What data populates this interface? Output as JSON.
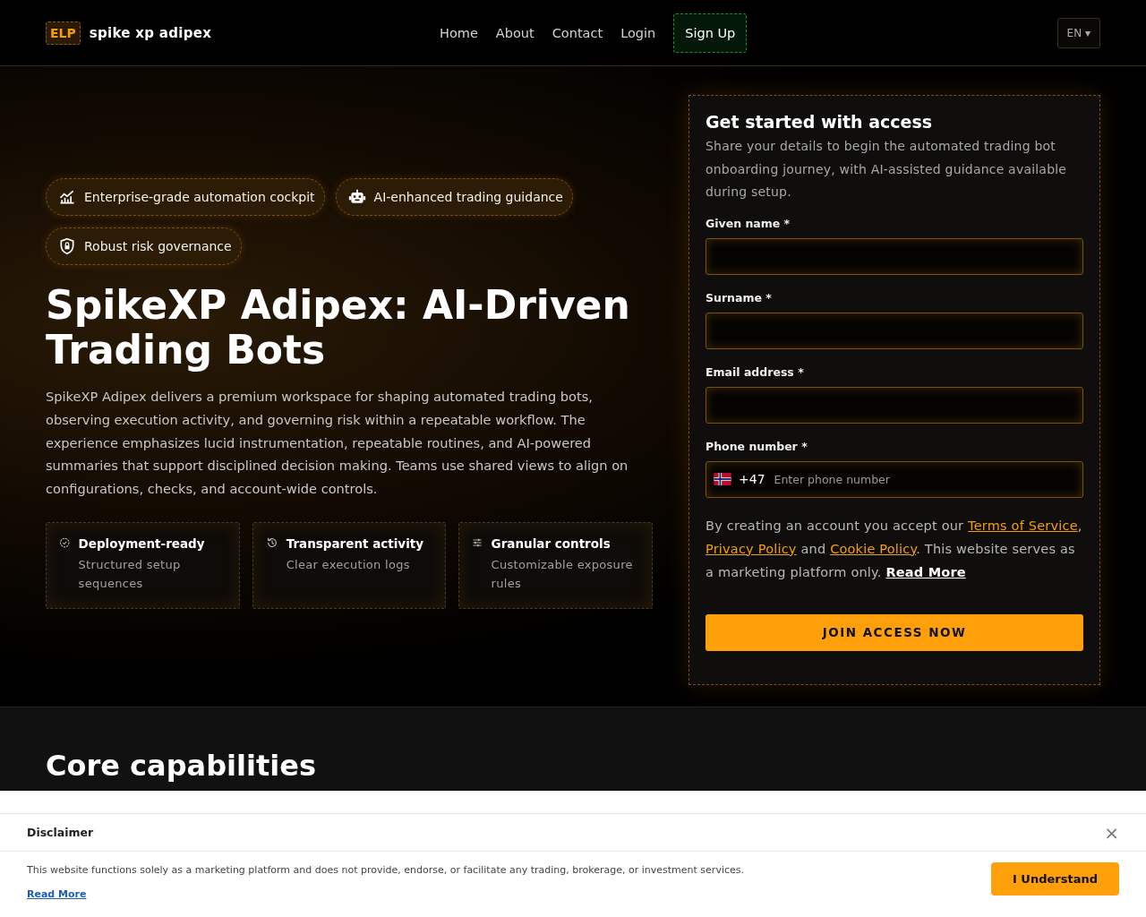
{
  "header": {
    "logo_badge": "ELP",
    "brand": "spike xp adipex",
    "nav": [
      {
        "label": "Home",
        "kind": "link"
      },
      {
        "label": "About",
        "kind": "link"
      },
      {
        "label": "Contact",
        "kind": "link"
      },
      {
        "label": "Login",
        "kind": "link"
      },
      {
        "label": "Sign Up",
        "kind": "button"
      }
    ],
    "language": "EN ▾"
  },
  "hero": {
    "badges": [
      {
        "label": "Enterprise-grade automation cockpit",
        "kind": "chart"
      },
      {
        "label": "AI-enhanced trading guidance",
        "kind": "robot"
      },
      {
        "label": "Robust risk governance",
        "kind": "shield"
      }
    ],
    "title": "SpikeXP Adipex: AI-Driven Trading Bots",
    "description": "SpikeXP Adipex delivers a premium workspace for shaping automated trading bots, observing execution activity, and governing risk within a repeatable workflow. The experience emphasizes lucid instrumentation, repeatable routines, and AI-powered summaries that support disciplined decision making. Teams use shared views to align on configurations, checks, and account-wide controls.",
    "features": [
      {
        "title": "Deployment-ready",
        "text": "Structured setup sequences",
        "kind": "check"
      },
      {
        "title": "Transparent activity",
        "text": "Clear execution logs",
        "kind": "history"
      },
      {
        "title": "Granular controls",
        "text": "Customizable exposure rules",
        "kind": "sliders"
      }
    ]
  },
  "form": {
    "title": "Get started with access",
    "subtitle": "Share your details to begin the automated trading bot onboarding journey, with AI-assisted guidance available during setup.",
    "fields": [
      {
        "label": "Given name *",
        "kind": "text"
      },
      {
        "label": "Surname *",
        "kind": "text"
      },
      {
        "label": "Email address *",
        "kind": "text"
      },
      {
        "label": "Phone number *",
        "kind": "phone",
        "prefix": "+47",
        "placeholder": "Enter phone number"
      }
    ],
    "consent": [
      {
        "text": "By creating an account you accept our ",
        "kind": "plain"
      },
      {
        "text": "Terms of Service",
        "kind": "link"
      },
      {
        "text": ", ",
        "kind": "plain"
      },
      {
        "text": "Privacy Policy",
        "kind": "link"
      },
      {
        "text": " and ",
        "kind": "plain"
      },
      {
        "text": "Cookie Policy",
        "kind": "link"
      },
      {
        "text": ". This website serves as a marketing platform only. ",
        "kind": "plain"
      },
      {
        "text": "Read More",
        "kind": "strong-link"
      }
    ],
    "submit": "JOIN ACCESS NOW"
  },
  "capabilities": {
    "title": "Core capabilities"
  },
  "disclaimer": {
    "title": "Disclaimer",
    "close": "×",
    "text": "This website functions solely as a marketing platform and does not provide, endorse, or facilitate any trading, brokerage, or investment services.",
    "link": "Read More",
    "button": "I Understand"
  }
}
